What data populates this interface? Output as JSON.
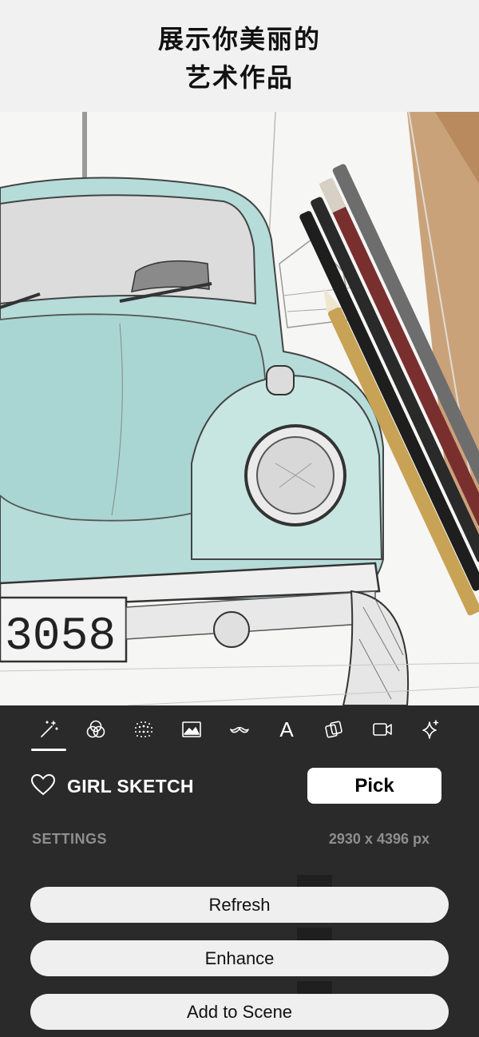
{
  "headline": {
    "line1": "展示你美丽的",
    "line2": "艺术作品"
  },
  "toolbar": {
    "tools": [
      {
        "icon": "magic-wand-icon"
      },
      {
        "icon": "color-circles-icon"
      },
      {
        "icon": "halftone-dots-icon"
      },
      {
        "icon": "image-icon"
      },
      {
        "icon": "mustache-icon"
      },
      {
        "icon": "text-icon",
        "glyph": "A"
      },
      {
        "icon": "layers-icon"
      },
      {
        "icon": "video-camera-icon"
      },
      {
        "icon": "sparkle-icon"
      }
    ],
    "active_index": 0
  },
  "style": {
    "name": "GIRL SKETCH",
    "favorite": false
  },
  "pick_label": "Pick",
  "settings": {
    "label": "SETTINGS",
    "dimensions": "2930 x 4396 px"
  },
  "actions": {
    "refresh": "Refresh",
    "enhance": "Enhance",
    "add_to_scene": "Add to Scene"
  },
  "artwork": {
    "plate_text": "3058"
  },
  "colors": {
    "panel_bg": "#2a2a2a",
    "button_bg": "#efefef",
    "car_tint": "#a9d6d2",
    "muted_text": "#8e8e8e"
  }
}
